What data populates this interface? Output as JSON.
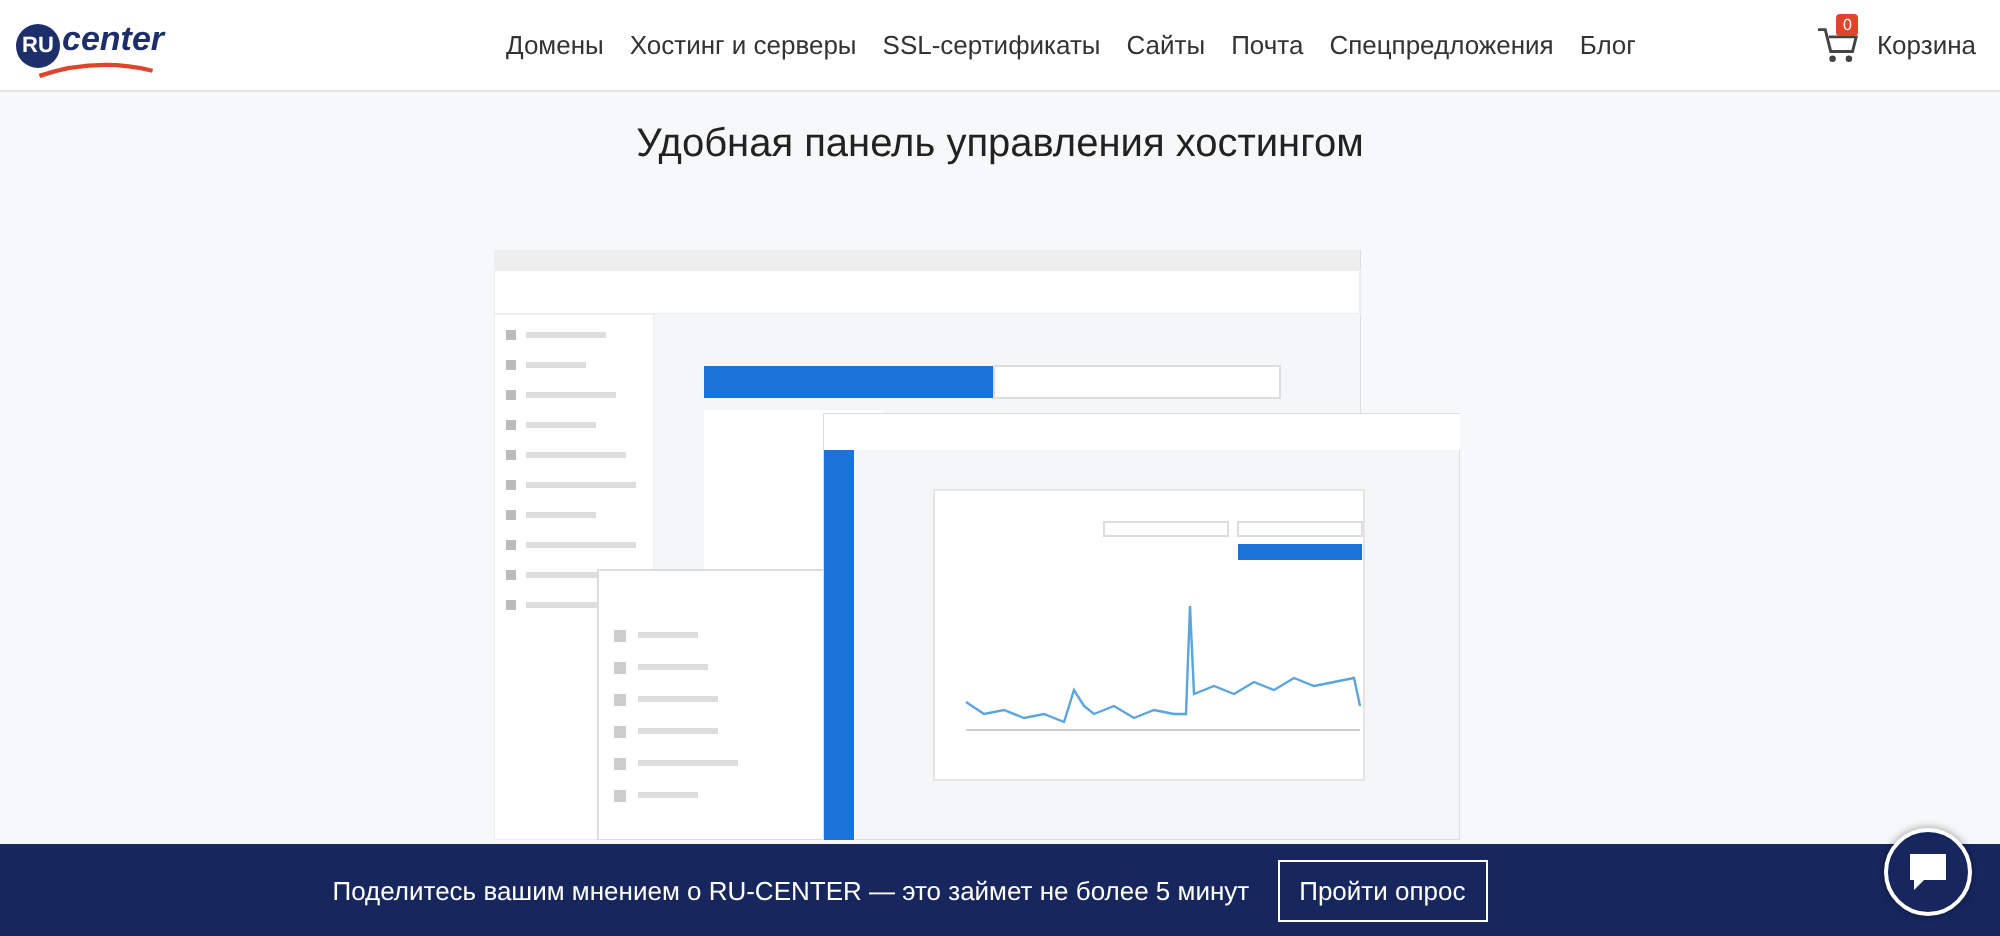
{
  "logo": {
    "badge": "RU",
    "word": "center"
  },
  "nav": [
    "Домены",
    "Хостинг и серверы",
    "SSL-сертификаты",
    "Сайты",
    "Почта",
    "Спецпредложения",
    "Блог"
  ],
  "cart": {
    "count": "0",
    "label": "Корзина"
  },
  "heading": "Удобная панель управления хостингом",
  "banner": {
    "text": "Поделитесь вашим мнением о RU-CENTER — это займет не более 5 минут",
    "button": "Пройти опрос"
  }
}
